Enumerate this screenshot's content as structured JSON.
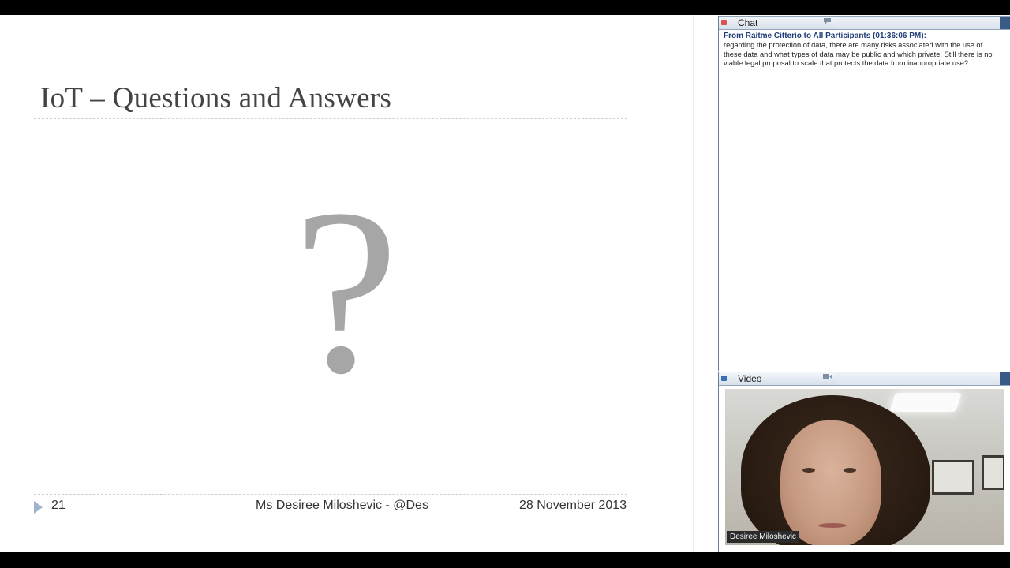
{
  "slide": {
    "title": "IoT – Questions and Answers",
    "symbol": "?",
    "footer": {
      "slide_number": "21",
      "presenter": "Ms Desiree Miloshevic - @Des",
      "date": "28 November 2013"
    }
  },
  "chat": {
    "panel_title": "Chat",
    "header_icon": "speech-bubble-icon",
    "message": {
      "from": "From Raitme Citterio to All Participants (01:36:06 PM):",
      "text": "regarding the protection of data, there are many risks associated with the use of these data and what types of data may be public and which private. Still there is no viable legal proposal to scale that protects the data from inappropriate use?"
    }
  },
  "video": {
    "panel_title": "Video",
    "header_icon": "camera-icon",
    "participant_name": "Desiree Miloshevic"
  },
  "colors": {
    "chat_dot": "#d9534f",
    "video_dot": "#3a6fb5",
    "slide_title_text": "#444444",
    "question_mark": "#a6a6a6",
    "footer_arrow": "#9fb4cc",
    "chat_from": "#1f3d7a"
  }
}
